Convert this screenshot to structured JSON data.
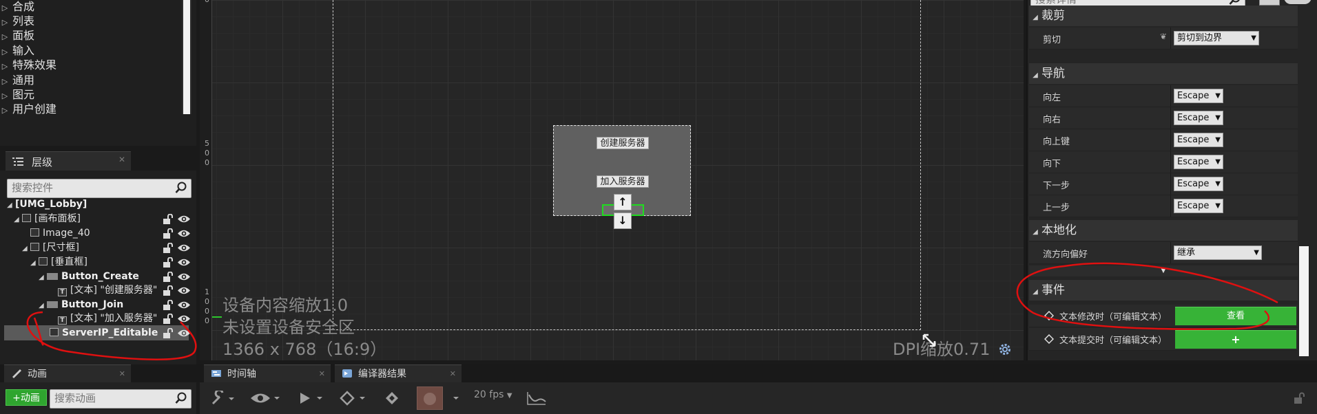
{
  "palette": {
    "items": [
      {
        "label": "合成"
      },
      {
        "label": "列表"
      },
      {
        "label": "面板"
      },
      {
        "label": "输入"
      },
      {
        "label": "特殊效果"
      },
      {
        "label": "通用"
      },
      {
        "label": "图元"
      },
      {
        "label": "用户创建"
      }
    ]
  },
  "hierarchy": {
    "tab_title": "层级",
    "search_placeholder": "搜索控件",
    "tree": [
      {
        "label": "[UMG_Lobby]",
        "icon": "none"
      },
      {
        "label": "[画布面板]",
        "icon": "canvas-panel-icon"
      },
      {
        "label": "Image_40",
        "icon": "image-icon"
      },
      {
        "label": "[尺寸框]",
        "icon": "size-box-icon"
      },
      {
        "label": "[垂直框]",
        "icon": "vertical-box-icon"
      },
      {
        "label": "Button_Create",
        "icon": "button-icon"
      },
      {
        "label": "[文本] \"创建服务器\"",
        "icon": "text-icon"
      },
      {
        "label": "Button_Join",
        "icon": "button-icon"
      },
      {
        "label": "[文本] \"加入服务器\"",
        "icon": "text-icon"
      },
      {
        "label": "ServerIP_Editable`",
        "icon": "editable-text-icon"
      }
    ]
  },
  "designer": {
    "ruler_marks": [
      "0",
      "5",
      "0",
      "0",
      "1",
      "0",
      "0",
      "0"
    ],
    "overlay_scale": "设备内容缩放1.0",
    "overlay_safe_zone": "未设置设备安全区",
    "overlay_resolution": "1366 x 768（16:9）",
    "dpi_scale": "DPI缩放0.71",
    "widget": {
      "create_button": "创建服务器",
      "join_button": "加入服务器",
      "up_arrow": "↑",
      "down_arrow": "↓"
    }
  },
  "details": {
    "search_placeholder": "搜索详情",
    "clipping": {
      "category": "裁剪",
      "label": "剪切",
      "value": "剪切到边界"
    },
    "navigation": {
      "category": "导航",
      "rows": [
        {
          "label": "向左",
          "value": "Escape"
        },
        {
          "label": "向右",
          "value": "Escape"
        },
        {
          "label": "向上键",
          "value": "Escape"
        },
        {
          "label": "向下",
          "value": "Escape"
        },
        {
          "label": "下一步",
          "value": "Escape"
        },
        {
          "label": "上一步",
          "value": "Escape"
        }
      ]
    },
    "localization": {
      "category": "本地化",
      "label": "流方向偏好",
      "value": "继承"
    },
    "events": {
      "category": "事件",
      "on_text_changed": "文本修改时（可编辑文本）",
      "view_button": "查看",
      "on_text_committed": "文本提交时（可编辑文本）",
      "add_button": "+"
    }
  },
  "bottom": {
    "animation_tab": "动画",
    "add_animation_button": "+动画",
    "animation_search_placeholder": "搜索动画",
    "timeline_tab": "时间轴",
    "compiler_tab": "编译器结果",
    "fps_label": "20 fps"
  },
  "colors": {
    "selection_green": "#1fdc1f",
    "accent_green": "#37b337",
    "annotation_red": "#e01010"
  }
}
